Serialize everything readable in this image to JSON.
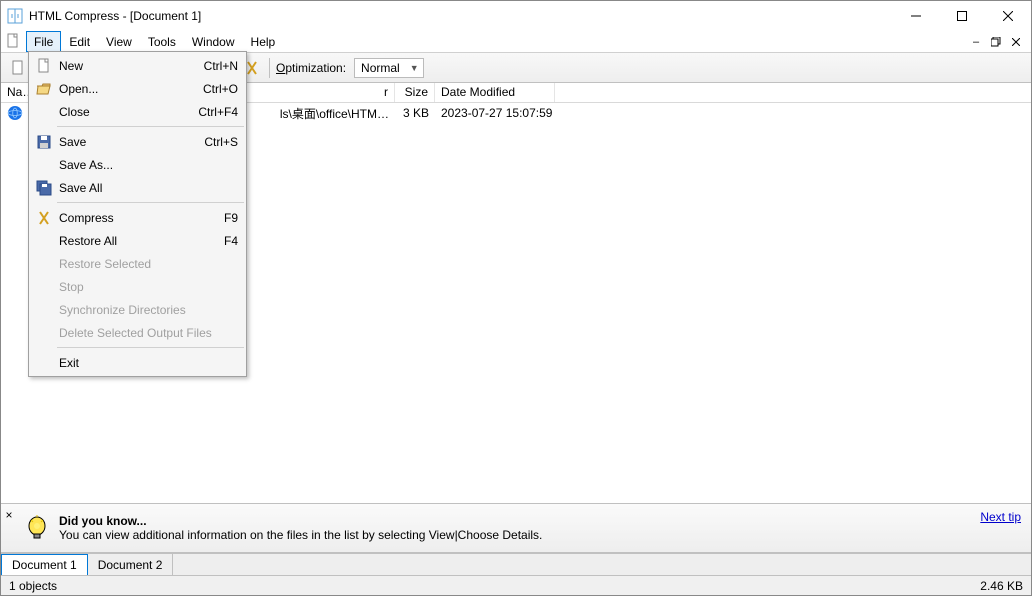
{
  "window": {
    "title": "HTML Compress - [Document 1]"
  },
  "menubar": {
    "file": "File",
    "edit": "Edit",
    "view": "View",
    "tools": "Tools",
    "window": "Window",
    "help": "Help"
  },
  "toolbar": {
    "opt_label": "Optimization:",
    "opt_value": "Normal"
  },
  "columns": {
    "name": "Na…",
    "folder": "r",
    "size": "Size",
    "date": "Date Modified"
  },
  "row": {
    "folder": "ls\\桌面\\office\\HTM…",
    "size": "3 KB",
    "date": "2023-07-27 15:07:59"
  },
  "file_menu": {
    "new": {
      "label": "New",
      "short": "Ctrl+N"
    },
    "open": {
      "label": "Open...",
      "short": "Ctrl+O"
    },
    "close": {
      "label": "Close",
      "short": "Ctrl+F4"
    },
    "save": {
      "label": "Save",
      "short": "Ctrl+S"
    },
    "saveas": {
      "label": "Save As..."
    },
    "saveall": {
      "label": "Save All"
    },
    "compress": {
      "label": "Compress",
      "short": "F9"
    },
    "restoreall": {
      "label": "Restore All",
      "short": "F4"
    },
    "restoresel": {
      "label": "Restore Selected"
    },
    "stop": {
      "label": "Stop"
    },
    "sync": {
      "label": "Synchronize Directories"
    },
    "delout": {
      "label": "Delete Selected Output Files"
    },
    "exit": {
      "label": "Exit"
    }
  },
  "tip": {
    "title": "Did you know...",
    "body": "You can view additional information on the files in the list by selecting View|Choose Details.",
    "next": "Next tip"
  },
  "tabs": {
    "doc1": "Document 1",
    "doc2": "Document 2"
  },
  "status": {
    "left": "1 objects",
    "right": "2.46 KB"
  }
}
